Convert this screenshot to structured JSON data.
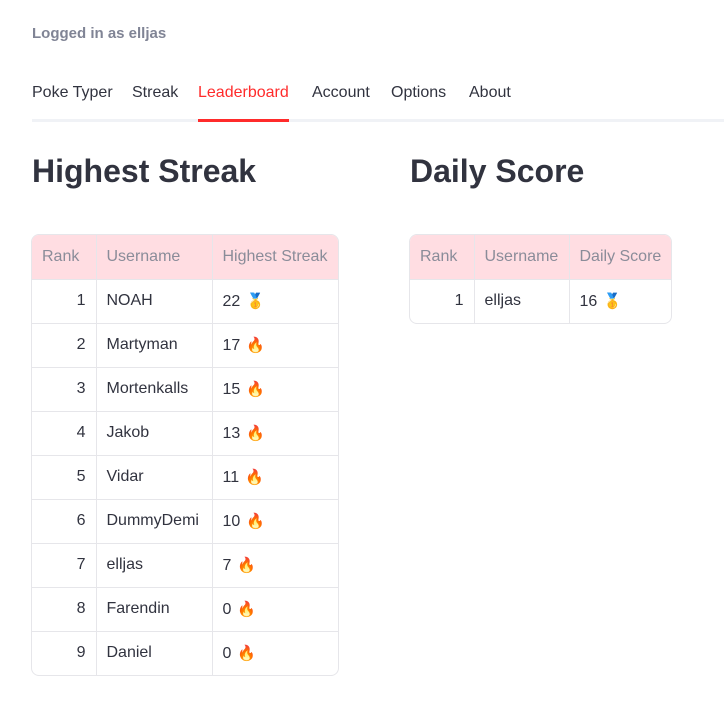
{
  "session": {
    "logged_in_text": "Logged in as elljas"
  },
  "tabs": [
    {
      "label": "Poke Typer",
      "active": false
    },
    {
      "label": "Streak",
      "active": false
    },
    {
      "label": "Leaderboard",
      "active": true
    },
    {
      "label": "Account",
      "active": false
    },
    {
      "label": "Options",
      "active": false
    },
    {
      "label": "About",
      "active": false
    }
  ],
  "accent_color": "#ff2b2b",
  "header_color": "#ffdde2",
  "highest_streak": {
    "title": "Highest Streak",
    "columns": [
      "Rank",
      "Username",
      "Highest Streak"
    ],
    "rows": [
      {
        "rank": "1",
        "username": "NOAH",
        "value": "22",
        "icon": "🥇",
        "icon_name": "gold-medal-icon"
      },
      {
        "rank": "2",
        "username": "Martyman",
        "value": "17",
        "icon": "🔥",
        "icon_name": "fire-icon"
      },
      {
        "rank": "3",
        "username": "Mortenkalls",
        "value": "15",
        "icon": "🔥",
        "icon_name": "fire-icon"
      },
      {
        "rank": "4",
        "username": "Jakob",
        "value": "13",
        "icon": "🔥",
        "icon_name": "fire-icon"
      },
      {
        "rank": "5",
        "username": "Vidar",
        "value": "11",
        "icon": "🔥",
        "icon_name": "fire-icon"
      },
      {
        "rank": "6",
        "username": "DummyDemi",
        "value": "10",
        "icon": "🔥",
        "icon_name": "fire-icon"
      },
      {
        "rank": "7",
        "username": "elljas",
        "value": "7",
        "icon": "🔥",
        "icon_name": "fire-icon"
      },
      {
        "rank": "8",
        "username": "Farendin",
        "value": "0",
        "icon": "🔥",
        "icon_name": "fire-icon"
      },
      {
        "rank": "9",
        "username": "Daniel",
        "value": "0",
        "icon": "🔥",
        "icon_name": "fire-icon"
      }
    ]
  },
  "daily_score": {
    "title": "Daily Score",
    "columns": [
      "Rank",
      "Username",
      "Daily Score"
    ],
    "rows": [
      {
        "rank": "1",
        "username": "elljas",
        "value": "16",
        "icon": "🥇",
        "icon_name": "gold-medal-icon"
      }
    ]
  }
}
